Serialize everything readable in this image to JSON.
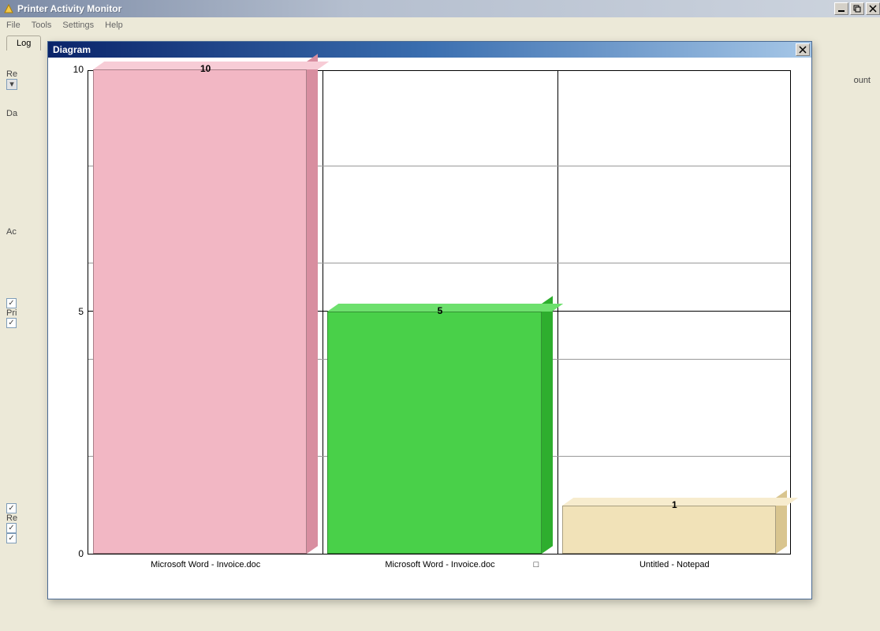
{
  "app": {
    "title": "Printer Activity Monitor",
    "menus": [
      "File",
      "Tools",
      "Settings",
      "Help"
    ],
    "tab": "Log"
  },
  "background": {
    "re_label": "Re",
    "da_label": "Da",
    "ac_label": "Ac",
    "pri_label": "Pri",
    "re2_label": "Re",
    "right_label": "ount"
  },
  "diagram": {
    "title": "Diagram"
  },
  "chart_data": {
    "type": "bar",
    "categories": [
      "Microsoft Word - Invoice.doc",
      "Microsoft Word - Invoice.doc",
      "Untitled  - Notepad"
    ],
    "category_extra": [
      "",
      "□",
      ""
    ],
    "values": [
      10,
      5,
      1
    ],
    "colors_front": [
      "#f2b7c4",
      "#49d049",
      "#f1e2b8"
    ],
    "colors_side": [
      "#d88ea0",
      "#2eae2e",
      "#d9c58f"
    ],
    "colors_top": [
      "#f7ccd6",
      "#6de06d",
      "#f7ecce"
    ],
    "yticks": [
      0,
      5,
      10
    ],
    "ylim": [
      0,
      10
    ],
    "title": "",
    "xlabel": "",
    "ylabel": ""
  }
}
